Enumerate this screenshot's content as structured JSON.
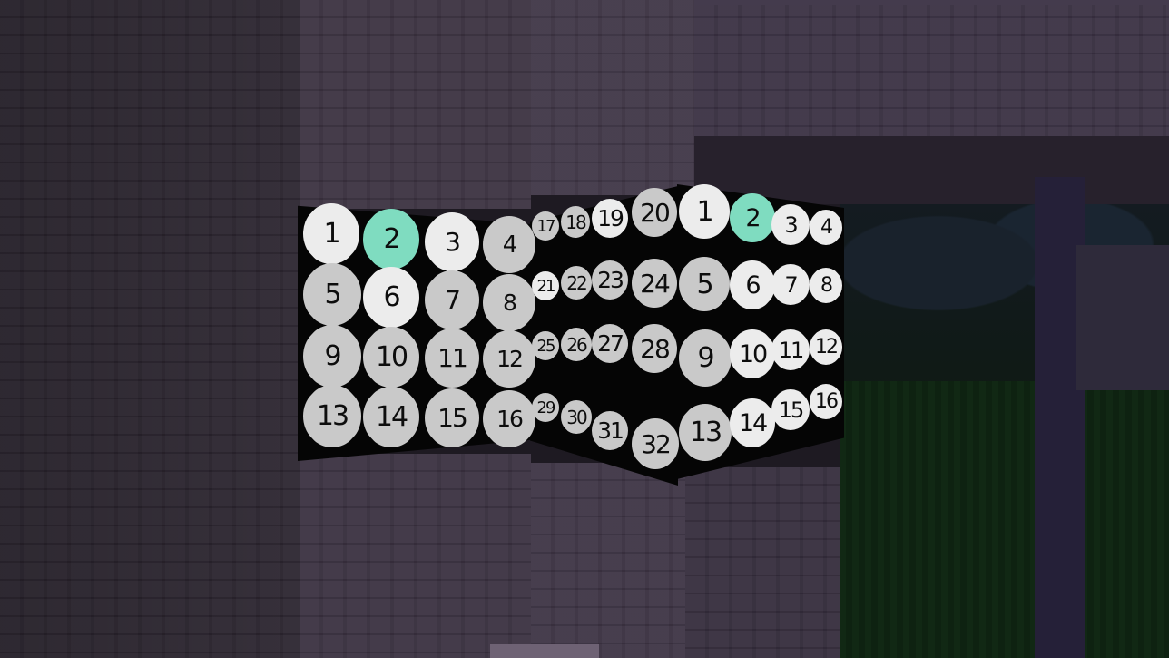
{
  "scene": {
    "description_free": true,
    "colors": {
      "selected": "#7fdcc0",
      "cell_bright": "#ececec",
      "cell_gray": "#c9c9c9",
      "panel_bg": "#050505"
    }
  },
  "panels": {
    "left": {
      "rows": [
        [
          {
            "n": "1",
            "s": "bright"
          },
          {
            "n": "2",
            "s": "sel"
          },
          {
            "n": "3",
            "s": "bright"
          },
          {
            "n": "4",
            "s": "gray"
          }
        ],
        [
          {
            "n": "5",
            "s": "gray"
          },
          {
            "n": "6",
            "s": "bright"
          },
          {
            "n": "7",
            "s": "gray"
          },
          {
            "n": "8",
            "s": "gray"
          }
        ],
        [
          {
            "n": "9",
            "s": "gray"
          },
          {
            "n": "10",
            "s": "gray"
          },
          {
            "n": "11",
            "s": "gray"
          },
          {
            "n": "12",
            "s": "gray"
          }
        ],
        [
          {
            "n": "13",
            "s": "gray"
          },
          {
            "n": "14",
            "s": "gray"
          },
          {
            "n": "15",
            "s": "gray"
          },
          {
            "n": "16",
            "s": "gray"
          }
        ]
      ]
    },
    "middle": {
      "rows": [
        [
          {
            "n": "17",
            "s": "gray"
          },
          {
            "n": "18",
            "s": "gray"
          },
          {
            "n": "19",
            "s": "bright"
          },
          {
            "n": "20",
            "s": "gray"
          }
        ],
        [
          {
            "n": "21",
            "s": "bright"
          },
          {
            "n": "22",
            "s": "gray"
          },
          {
            "n": "23",
            "s": "gray"
          },
          {
            "n": "24",
            "s": "gray"
          }
        ],
        [
          {
            "n": "25",
            "s": "gray"
          },
          {
            "n": "26",
            "s": "gray"
          },
          {
            "n": "27",
            "s": "gray"
          },
          {
            "n": "28",
            "s": "gray"
          }
        ],
        [
          {
            "n": "29",
            "s": "gray"
          },
          {
            "n": "30",
            "s": "gray"
          },
          {
            "n": "31",
            "s": "gray"
          },
          {
            "n": "32",
            "s": "gray"
          }
        ]
      ]
    },
    "right": {
      "rows": [
        [
          {
            "n": "1",
            "s": "bright"
          },
          {
            "n": "2",
            "s": "sel"
          },
          {
            "n": "3",
            "s": "bright"
          },
          {
            "n": "4",
            "s": "bright"
          }
        ],
        [
          {
            "n": "5",
            "s": "gray"
          },
          {
            "n": "6",
            "s": "bright"
          },
          {
            "n": "7",
            "s": "bright"
          },
          {
            "n": "8",
            "s": "bright"
          }
        ],
        [
          {
            "n": "9",
            "s": "gray"
          },
          {
            "n": "10",
            "s": "bright"
          },
          {
            "n": "11",
            "s": "bright"
          },
          {
            "n": "12",
            "s": "bright"
          }
        ],
        [
          {
            "n": "13",
            "s": "gray"
          },
          {
            "n": "14",
            "s": "bright"
          },
          {
            "n": "15",
            "s": "bright"
          },
          {
            "n": "16",
            "s": "bright"
          }
        ]
      ]
    }
  }
}
